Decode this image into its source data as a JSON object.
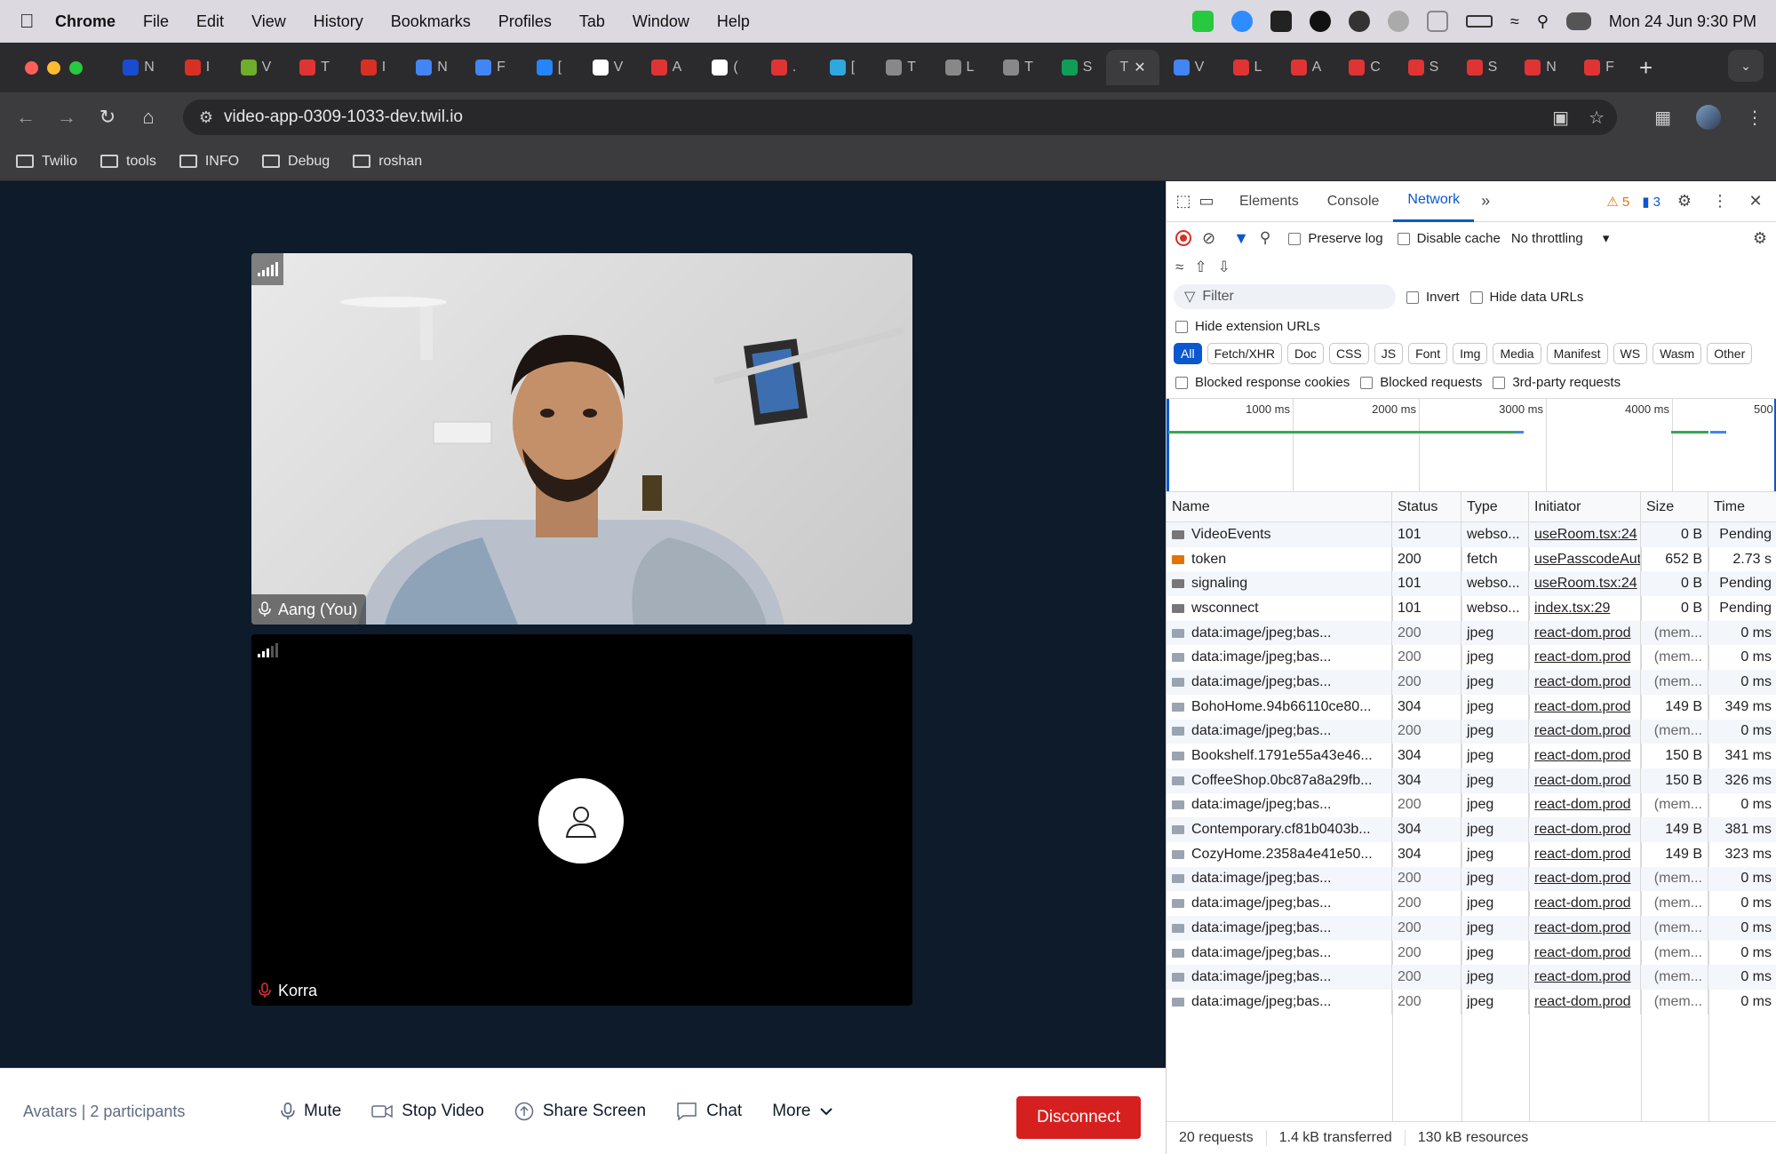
{
  "menubar": {
    "app": "Chrome",
    "items": [
      "File",
      "Edit",
      "View",
      "History",
      "Bookmarks",
      "Profiles",
      "Tab",
      "Window",
      "Help"
    ],
    "clock": "Mon 24 Jun  9:30 PM"
  },
  "browser": {
    "url": "video-app-0309-1033-dev.twil.io",
    "active_tab_title": "T",
    "bookmarks": [
      "Twilio",
      "tools",
      "INFO",
      "Debug",
      "roshan"
    ]
  },
  "tabs": [
    {
      "letter": "N",
      "color": "#1a4bd1"
    },
    {
      "letter": "I",
      "color": "#d93025"
    },
    {
      "letter": "V",
      "color": "#6fae2a"
    },
    {
      "letter": "T",
      "color": "#e03434"
    },
    {
      "letter": "I",
      "color": "#d93025"
    },
    {
      "letter": "N",
      "color": "#4285f4"
    },
    {
      "letter": "F",
      "color": "#4285f4"
    },
    {
      "letter": "[",
      "color": "#2684ff"
    },
    {
      "letter": "V",
      "color": "#ffffff"
    },
    {
      "letter": "A",
      "color": "#e03434"
    },
    {
      "letter": "(",
      "color": "#ffffff"
    },
    {
      "letter": ".",
      "color": "#e03434"
    },
    {
      "letter": "[",
      "color": "#2ea8e0"
    },
    {
      "letter": "T",
      "color": "#888888"
    },
    {
      "letter": "L",
      "color": "#888888"
    },
    {
      "letter": "T",
      "color": "#888888"
    },
    {
      "letter": "S",
      "color": "#0f9d58"
    }
  ],
  "tabs_after": [
    {
      "letter": "V",
      "color": "#4285f4"
    },
    {
      "letter": "L",
      "color": "#e03434"
    },
    {
      "letter": "A",
      "color": "#e03434"
    },
    {
      "letter": "C",
      "color": "#e03434"
    },
    {
      "letter": "S",
      "color": "#e03434"
    },
    {
      "letter": "S",
      "color": "#e03434"
    },
    {
      "letter": "N",
      "color": "#e03434"
    },
    {
      "letter": "F",
      "color": "#e03434"
    }
  ],
  "video": {
    "participant1": {
      "name": "Aang (You)"
    },
    "participant2": {
      "name": "Korra"
    },
    "room_label": "Avatars | 2 participants",
    "buttons": {
      "mute": "Mute",
      "stop_video": "Stop Video",
      "share_screen": "Share Screen",
      "chat": "Chat",
      "more": "More",
      "disconnect": "Disconnect"
    }
  },
  "devtools": {
    "tabs": [
      "Elements",
      "Console",
      "Network"
    ],
    "active_tab": "Network",
    "warnings": "5",
    "messages": "3",
    "preserve_log": "Preserve log",
    "disable_cache": "Disable cache",
    "throttling": "No throttling",
    "filter_placeholder": "Filter",
    "invert": "Invert",
    "hide_data_urls": "Hide data URLs",
    "hide_extension_urls": "Hide extension URLs",
    "chips": [
      "All",
      "Fetch/XHR",
      "Doc",
      "CSS",
      "JS",
      "Font",
      "Img",
      "Media",
      "Manifest",
      "WS",
      "Wasm",
      "Other"
    ],
    "blocked_response_cookies": "Blocked response cookies",
    "blocked_requests": "Blocked requests",
    "third_party": "3rd-party requests",
    "timeline_ticks": [
      "1000 ms",
      "2000 ms",
      "3000 ms",
      "4000 ms",
      "500"
    ],
    "columns": [
      "Name",
      "Status",
      "Type",
      "Initiator",
      "Size",
      "Time"
    ],
    "rows": [
      {
        "name": "VideoEvents",
        "status": "101",
        "type": "webso...",
        "initiator": "useRoom.tsx:24",
        "size": "0 B",
        "time": "Pending",
        "icon": "ws"
      },
      {
        "name": "token",
        "status": "200",
        "type": "fetch",
        "initiator": "usePasscodeAut",
        "size": "652 B",
        "time": "2.73 s",
        "icon": "fetch"
      },
      {
        "name": "signaling",
        "status": "101",
        "type": "webso...",
        "initiator": "useRoom.tsx:24",
        "size": "0 B",
        "time": "Pending",
        "icon": "ws"
      },
      {
        "name": "wsconnect",
        "status": "101",
        "type": "webso...",
        "initiator": "index.tsx:29",
        "size": "0 B",
        "time": "Pending",
        "icon": "ws"
      },
      {
        "name": "data:image/jpeg;bas...",
        "status": "200",
        "type": "jpeg",
        "initiator": "react-dom.prod",
        "size": "(mem...",
        "time": "0 ms",
        "icon": "img"
      },
      {
        "name": "data:image/jpeg;bas...",
        "status": "200",
        "type": "jpeg",
        "initiator": "react-dom.prod",
        "size": "(mem...",
        "time": "0 ms",
        "icon": "img"
      },
      {
        "name": "data:image/jpeg;bas...",
        "status": "200",
        "type": "jpeg",
        "initiator": "react-dom.prod",
        "size": "(mem...",
        "time": "0 ms",
        "icon": "img"
      },
      {
        "name": "BohoHome.94b66110ce80...",
        "status": "304",
        "type": "jpeg",
        "initiator": "react-dom.prod",
        "size": "149 B",
        "time": "349 ms",
        "icon": "img"
      },
      {
        "name": "data:image/jpeg;bas...",
        "status": "200",
        "type": "jpeg",
        "initiator": "react-dom.prod",
        "size": "(mem...",
        "time": "0 ms",
        "icon": "img"
      },
      {
        "name": "Bookshelf.1791e55a43e46...",
        "status": "304",
        "type": "jpeg",
        "initiator": "react-dom.prod",
        "size": "150 B",
        "time": "341 ms",
        "icon": "img"
      },
      {
        "name": "CoffeeShop.0bc87a8a29fb...",
        "status": "304",
        "type": "jpeg",
        "initiator": "react-dom.prod",
        "size": "150 B",
        "time": "326 ms",
        "icon": "img"
      },
      {
        "name": "data:image/jpeg;bas...",
        "status": "200",
        "type": "jpeg",
        "initiator": "react-dom.prod",
        "size": "(mem...",
        "time": "0 ms",
        "icon": "img"
      },
      {
        "name": "Contemporary.cf81b0403b...",
        "status": "304",
        "type": "jpeg",
        "initiator": "react-dom.prod",
        "size": "149 B",
        "time": "381 ms",
        "icon": "img"
      },
      {
        "name": "CozyHome.2358a4e41e50...",
        "status": "304",
        "type": "jpeg",
        "initiator": "react-dom.prod",
        "size": "149 B",
        "time": "323 ms",
        "icon": "img"
      },
      {
        "name": "data:image/jpeg;bas...",
        "status": "200",
        "type": "jpeg",
        "initiator": "react-dom.prod",
        "size": "(mem...",
        "time": "0 ms",
        "icon": "img"
      },
      {
        "name": "data:image/jpeg;bas...",
        "status": "200",
        "type": "jpeg",
        "initiator": "react-dom.prod",
        "size": "(mem...",
        "time": "0 ms",
        "icon": "img"
      },
      {
        "name": "data:image/jpeg;bas...",
        "status": "200",
        "type": "jpeg",
        "initiator": "react-dom.prod",
        "size": "(mem...",
        "time": "0 ms",
        "icon": "img"
      },
      {
        "name": "data:image/jpeg;bas...",
        "status": "200",
        "type": "jpeg",
        "initiator": "react-dom.prod",
        "size": "(mem...",
        "time": "0 ms",
        "icon": "img"
      },
      {
        "name": "data:image/jpeg;bas...",
        "status": "200",
        "type": "jpeg",
        "initiator": "react-dom.prod",
        "size": "(mem...",
        "time": "0 ms",
        "icon": "img"
      },
      {
        "name": "data:image/jpeg;bas...",
        "status": "200",
        "type": "jpeg",
        "initiator": "react-dom.prod",
        "size": "(mem...",
        "time": "0 ms",
        "icon": "img"
      }
    ],
    "summary": {
      "requests": "20 requests",
      "transferred": "1.4 kB transferred",
      "resources": "130 kB resources"
    }
  }
}
